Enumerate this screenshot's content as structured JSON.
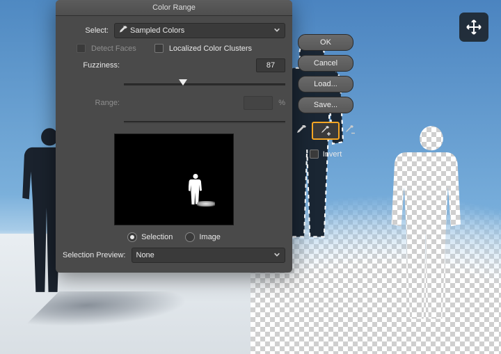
{
  "dialog": {
    "title": "Color Range",
    "select_label": "Select:",
    "select_value": "Sampled Colors",
    "detect_faces": "Detect Faces",
    "localized": "Localized Color Clusters",
    "fuzziness_label": "Fuzziness:",
    "fuzziness_value": "87",
    "range_label": "Range:",
    "range_unit": "%",
    "radio_selection": "Selection",
    "radio_image": "Image",
    "selection_preview_label": "Selection Preview:",
    "selection_preview_value": "None",
    "invert_label": "Invert"
  },
  "buttons": {
    "ok": "OK",
    "cancel": "Cancel",
    "load": "Load...",
    "save": "Save..."
  },
  "eyedroppers": {
    "sample": "eyedropper",
    "add": "eyedropper-plus",
    "subtract": "eyedropper-minus",
    "selected": "add"
  },
  "tool": {
    "name": "move-tool"
  },
  "colors": {
    "accent": "#f5a623",
    "panel": "#4a4a4a",
    "field": "#3a3a3a"
  }
}
